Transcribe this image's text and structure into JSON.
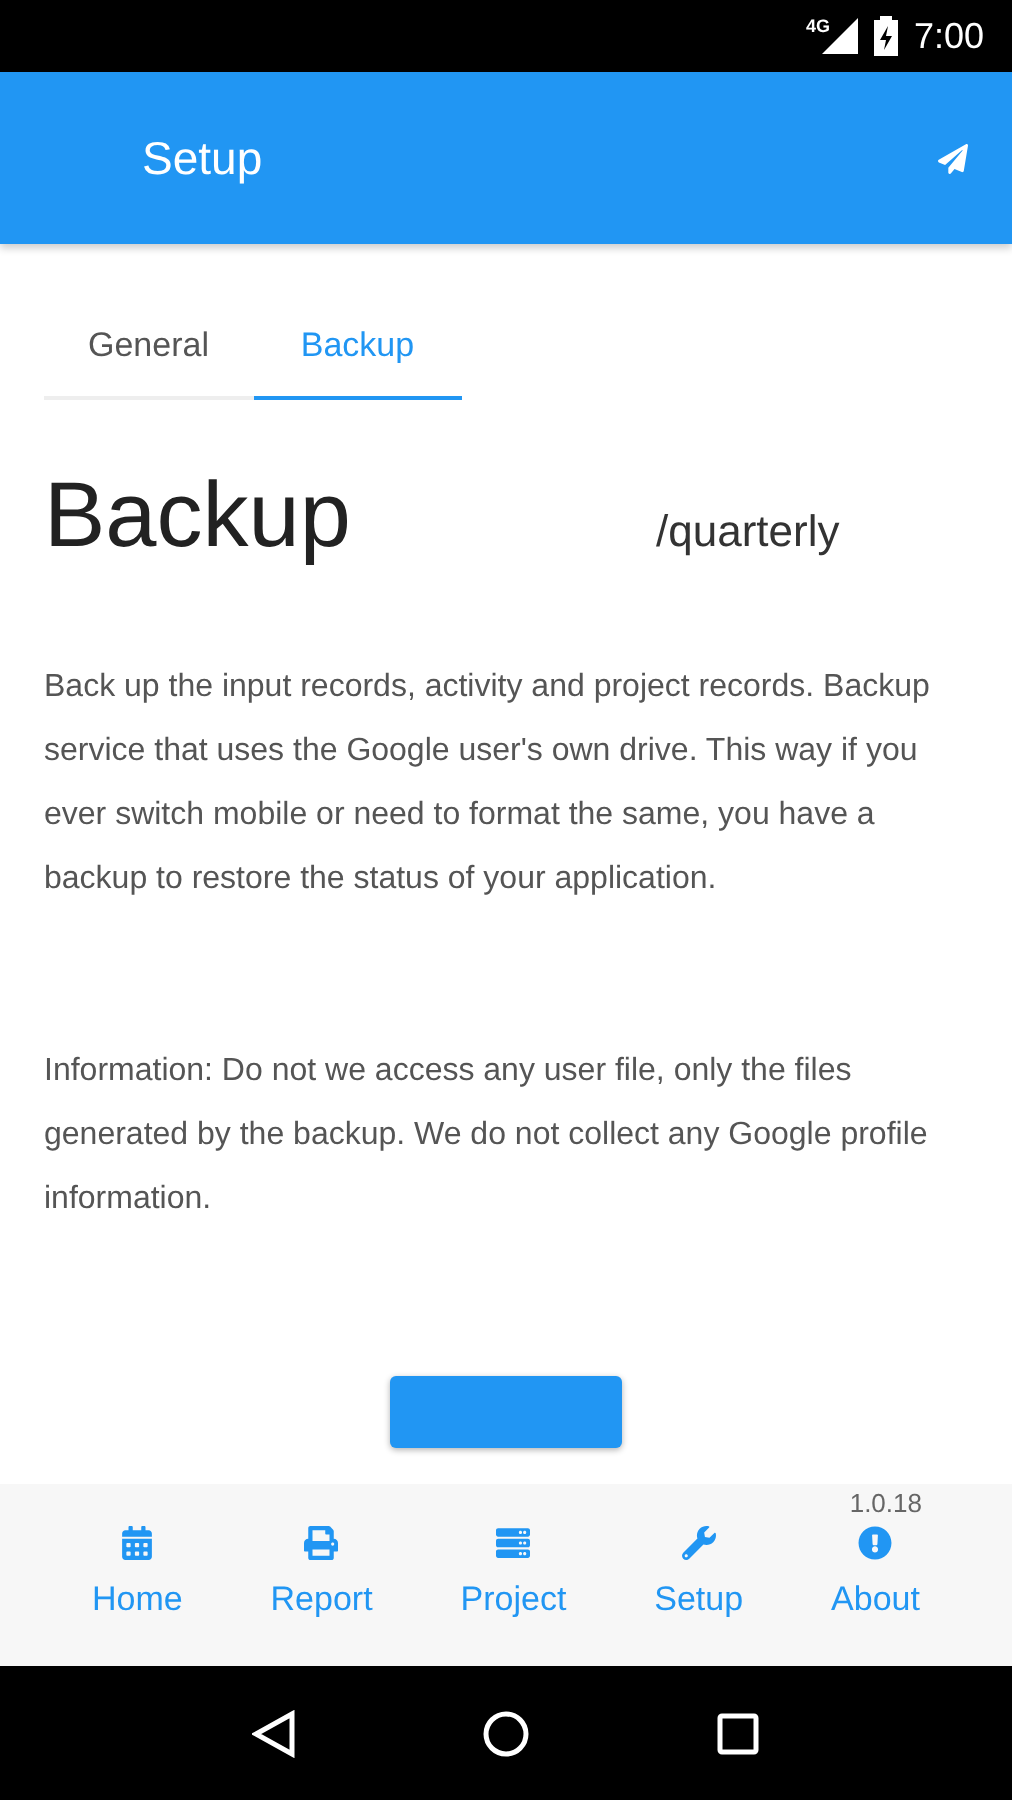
{
  "status_bar": {
    "network": "4G",
    "time": "7:00"
  },
  "app_bar": {
    "title": "Setup"
  },
  "tabs": [
    {
      "label": "General",
      "selected": false
    },
    {
      "label": "Backup",
      "selected": true
    }
  ],
  "heading": "Backup",
  "period": "/quarterly",
  "paragraphs": [
    "Back up the input records, activity and project records. Backup service that uses the Google user's own drive. This way if you ever switch mobile or need to format the same, you have a backup to restore the status of your application.",
    "Information: Do not we access any user file, only the files generated by the backup. We do not collect any Google profile information."
  ],
  "version": "1.0.18",
  "bottom_nav": [
    {
      "label": "Home",
      "kind": "calendar"
    },
    {
      "label": "Report",
      "kind": "printer"
    },
    {
      "label": "Project",
      "kind": "list"
    },
    {
      "label": "Setup",
      "kind": "wrench"
    },
    {
      "label": "About",
      "kind": "info"
    }
  ]
}
